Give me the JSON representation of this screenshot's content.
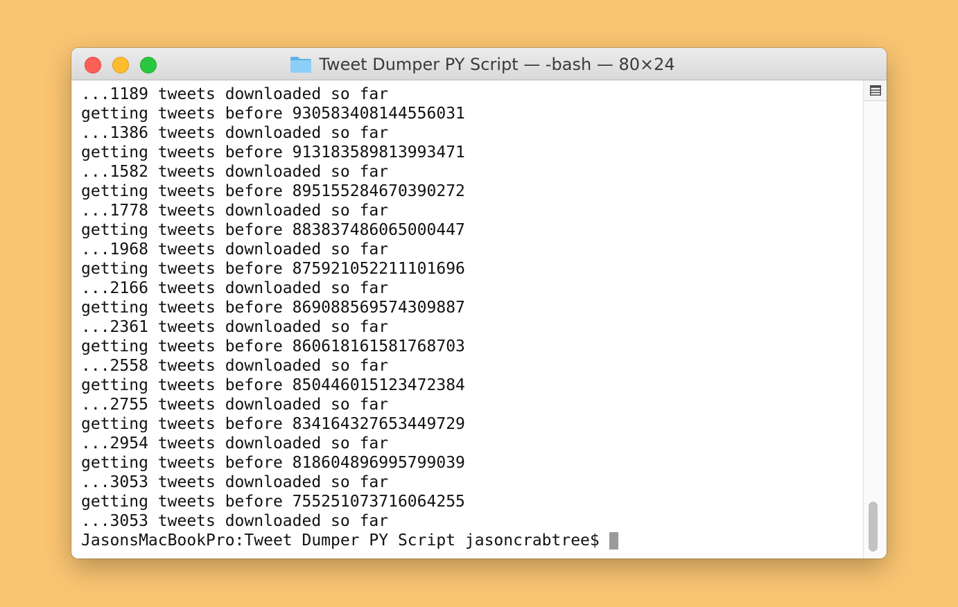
{
  "window": {
    "title": "Tweet Dumper PY Script — -bash — 80×24"
  },
  "terminal": {
    "lines": [
      "...1189 tweets downloaded so far",
      "getting tweets before 930583408144556031",
      "...1386 tweets downloaded so far",
      "getting tweets before 913183589813993471",
      "...1582 tweets downloaded so far",
      "getting tweets before 895155284670390272",
      "...1778 tweets downloaded so far",
      "getting tweets before 883837486065000447",
      "...1968 tweets downloaded so far",
      "getting tweets before 875921052211101696",
      "...2166 tweets downloaded so far",
      "getting tweets before 869088569574309887",
      "...2361 tweets downloaded so far",
      "getting tweets before 860618161581768703",
      "...2558 tweets downloaded so far",
      "getting tweets before 850446015123472384",
      "...2755 tweets downloaded so far",
      "getting tweets before 834164327653449729",
      "...2954 tweets downloaded so far",
      "getting tweets before 818604896995799039",
      "...3053 tweets downloaded so far",
      "getting tweets before 755251073716064255",
      "...3053 tweets downloaded so far"
    ],
    "prompt": "JasonsMacBookPro:Tweet Dumper PY Script jasoncrabtree$"
  },
  "icons": {
    "folder": "folder-icon",
    "split_pane": "split-pane-icon"
  },
  "colors": {
    "background": "#fac572",
    "close": "#fc5f57",
    "minimize": "#fdbc2e",
    "zoom": "#28c840",
    "folder": "#7cc4f2"
  }
}
